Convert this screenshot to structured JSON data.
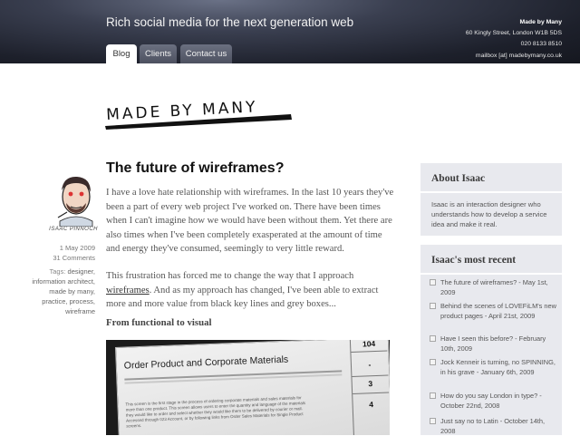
{
  "header": {
    "tagline": "Rich social media for the next generation web",
    "contact": {
      "org": "Made by Many",
      "address": "60 Kingly Street, London W1B 5DS",
      "phone": "020 8133 8510",
      "email": "mailbox [at] madebymany.co.uk"
    },
    "tabs": [
      {
        "label": "Blog",
        "active": true
      },
      {
        "label": "Clients",
        "active": false
      },
      {
        "label": "Contact us",
        "active": false
      }
    ]
  },
  "logo": {
    "text": "MADE BY MANY"
  },
  "author": {
    "name": "ISAAC PINNOCH",
    "date": "1 May 2009",
    "comments": "31 Comments",
    "tags_label": "Tags:",
    "tags": [
      "designer,",
      "information architect,",
      "made by many,",
      "practice,",
      "process,",
      "wireframe"
    ]
  },
  "post": {
    "title": "The future of wireframes?",
    "p1": "I have a love hate relationship with wireframes. In the last 10 years they've been a part of every web project I've worked on. There have been times when I can't imagine how we would have been without them. Yet there are also times when I've been completely exasperated at the amount of time and energy they've consumed, seemingly to very little reward.",
    "p2_before": "This frustration has forced me to change the way that I approach ",
    "p2_link": "wireframes",
    "p2_after": ". And as my approach has changed, I've been able to extract more and more value from black key lines and grey boxes...",
    "subheading": "From functional to visual",
    "photo": {
      "paper_title": "Order Product and Corporate Materials",
      "paper_text": "This screen is the first stage in the process of ordering corporate materials and sales materials for more than one product. This screen allows users to enter the quantity and language of the materials they would like to order and select whether they would like them to be delivered by courier or mail. Accessed through 023 Account, or by following links from Order Sales Materials for Single Product screens.",
      "numbers": [
        "104",
        "3",
        "4"
      ]
    }
  },
  "sidebar": {
    "about_title": "About Isaac",
    "about_text": "Isaac is an interaction designer who understands how to develop a service idea and make it real.",
    "recent_title": "Isaac's most recent",
    "recent": [
      "The future of wireframes? - May 1st, 2009",
      "Behind the scenes of LOVEFiLM's new product pages - April 21st, 2009",
      "Have I seen this before? - February 10th, 2009",
      "Jock Kenneir is turning, no SPINNING, in his grave - January 6th, 2009",
      "How do you say London in type? - October 22nd, 2008",
      "Just say no to Latin - October 14th, 2008"
    ]
  },
  "colors": {
    "header_bg": "#1d202b",
    "sidebar_bg": "#e8e9ee",
    "tab_active": "#ffffff"
  }
}
